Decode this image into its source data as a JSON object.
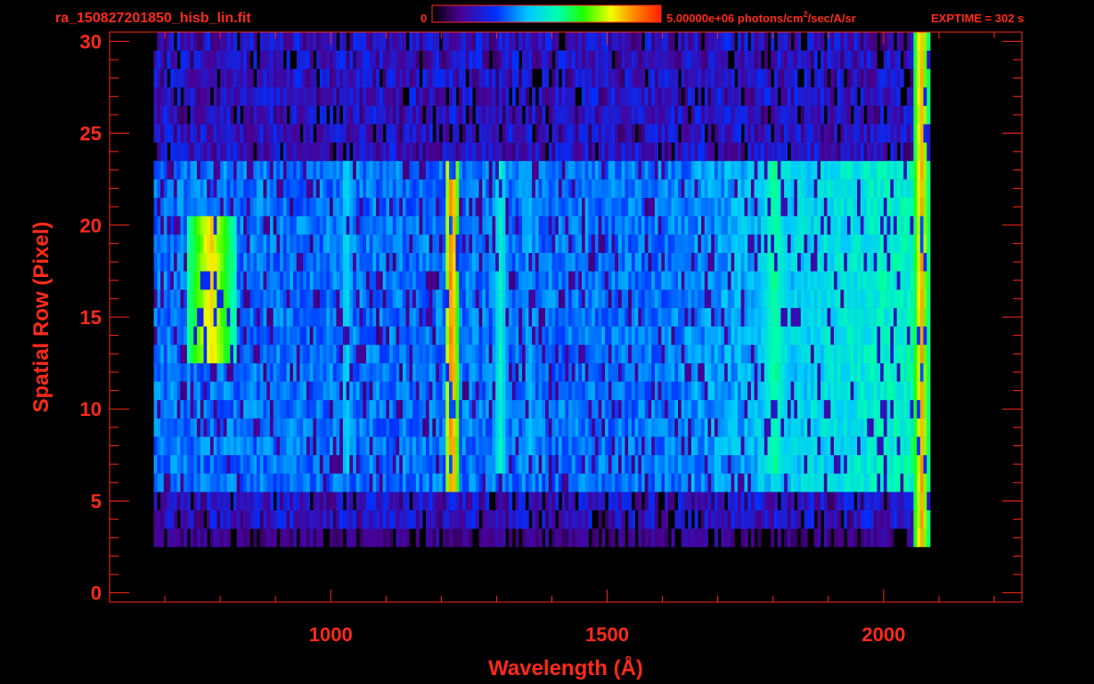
{
  "header": {
    "filename": "ra_150827201850_hisb_lin.fit",
    "colorbar_min": "0",
    "colorbar_max_value": "5.00000e+06 photons/cm",
    "colorbar_max_sup": "2",
    "colorbar_max_rest": "/sec/A/sr",
    "exptime": "EXPTIME = 302 s"
  },
  "colors": {
    "axis": "#ff2a1a",
    "background": "#000000"
  },
  "chart_data": {
    "type": "heatmap",
    "title": "",
    "xlabel": "Wavelength (Å)",
    "ylabel": "Spatial Row (Pixel)",
    "xlim": [
      600,
      2250
    ],
    "ylim": [
      -0.5,
      30.5
    ],
    "x_ticks": [
      "1000",
      "1500",
      "2000"
    ],
    "y_ticks": [
      "0",
      "5",
      "10",
      "15",
      "20",
      "25",
      "30"
    ],
    "colorbar": {
      "min": 0,
      "max": 5000000,
      "units": "photons/cm^2/sec/A/sr",
      "colormap": "rainbow"
    },
    "detector_extent": {
      "x_min": 680,
      "x_max": 2080,
      "row_min": 4,
      "row_max": 30
    },
    "slit_rows": [
      6,
      23
    ],
    "features": [
      {
        "name": "bright emission line",
        "wavelength": 1216,
        "rows": [
          6,
          23
        ],
        "level": 0.95
      },
      {
        "name": "emission line",
        "wavelength": 1026,
        "rows": [
          7,
          23
        ],
        "level": 0.5
      },
      {
        "name": "emission line",
        "wavelength": 1304,
        "rows": [
          7,
          23
        ],
        "level": 0.55
      },
      {
        "name": "emission line",
        "wavelength": 1356,
        "rows": [
          7,
          23
        ],
        "level": 0.45
      },
      {
        "name": "continuum band",
        "wavelength": 1800,
        "rows": [
          7,
          23
        ],
        "level": 0.6
      },
      {
        "name": "bright patch",
        "wavelength": 780,
        "rows": [
          13,
          20
        ],
        "level": 0.85
      },
      {
        "name": "edge line",
        "wavelength": 2065,
        "rows": [
          1,
          30
        ],
        "level": 0.9
      }
    ]
  }
}
